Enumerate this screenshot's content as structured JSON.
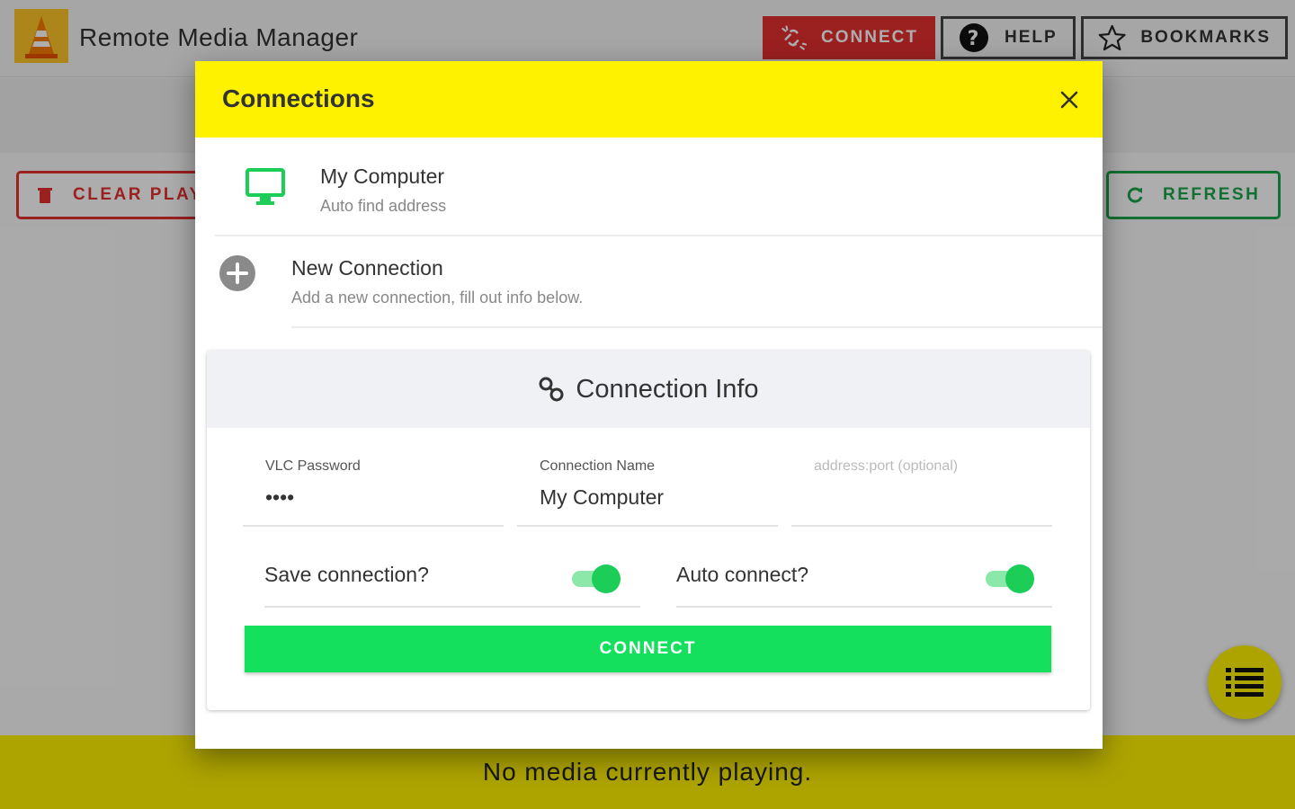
{
  "app": {
    "title": "Remote Media Manager",
    "toolbar": {
      "connect_label": "CONNECT",
      "help_label": "HELP",
      "bookmarks_label": "BOOKMARKS"
    },
    "actions": {
      "clear_label": "CLEAR PLAY",
      "refresh_label": "REFRESH"
    },
    "now_playing": "No media currently playing."
  },
  "modal": {
    "title": "Connections",
    "items": [
      {
        "primary": "My Computer",
        "secondary": "Auto find address",
        "icon": "monitor-icon"
      },
      {
        "primary": "New Connection",
        "secondary": "Add a new connection, fill out info below.",
        "icon": "add-circle-icon"
      }
    ],
    "info": {
      "title": "Connection Info",
      "password_label": "VLC Password",
      "password_value": "••••",
      "name_label": "Connection Name",
      "name_value": "My Computer",
      "address_placeholder": "address:port (optional)",
      "save_label": "Save connection?",
      "save_on": true,
      "auto_label": "Auto connect?",
      "auto_on": true,
      "connect_label": "CONNECT"
    }
  },
  "colors": {
    "accent_yellow": "#fff200",
    "connect_red": "#e53030",
    "green": "#14e05e",
    "refresh_green": "#1aa64a"
  }
}
